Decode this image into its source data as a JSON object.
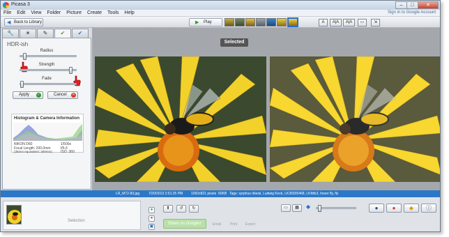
{
  "window": {
    "title": "Picasa 3",
    "buttons": {
      "minimize": "–",
      "maximize": "□",
      "close": "✕"
    }
  },
  "menu": {
    "items": [
      "File",
      "Edit",
      "View",
      "Folder",
      "Picture",
      "Create",
      "Tools",
      "Help"
    ],
    "sign_in": "Sign in to Google Account"
  },
  "toolbar": {
    "back_label": "Back to Library",
    "play_label": "Play",
    "text_buttons": [
      "A",
      "A|A",
      "A|A"
    ]
  },
  "edit_tabs": [
    "wrench-icon",
    "sun-icon",
    "brush-icon",
    "effects-icon",
    "effects2-icon"
  ],
  "effect_panel": {
    "title": "HDR-ish",
    "sliders": [
      {
        "label": "Radius",
        "value": 0.05
      },
      {
        "label": "Strength",
        "value": 0.95
      },
      {
        "label": "Fade",
        "value": 0.0
      }
    ],
    "apply_label": "Apply",
    "cancel_label": "Cancel"
  },
  "histogram": {
    "title": "Histogram & Camera Information",
    "camera_model": "NIKON D60",
    "focal_length": "Focal Length: 200.0mm",
    "equiv": "(35mm equivalent: 300mm)",
    "shutter": "1/500s",
    "aperture": "f/5.6",
    "iso": "ISO: 360"
  },
  "viewer": {
    "badge": "Selected"
  },
  "info_bar": {
    "filename": "LR_M72-83.jpg",
    "date": "7/20/2013 2:51:25 PM",
    "dimensions": "1092x821 pixels",
    "filesize": "60KB",
    "tags": "Tags: syrphus ribesii, Ludwig Keck, LK35935468, LKfdfx3, hover fly, fly"
  },
  "bottom": {
    "selection_label": "Selection",
    "share_label": "Share on Google+",
    "actions": [
      "Email",
      "Print",
      "Export"
    ]
  },
  "colors": {
    "accent": "#2b78c8",
    "window_bg": "#d9dde3",
    "viewer_bg": "#a4a8ad",
    "apply_green": "#2f9a2f",
    "cancel_red": "#d23a2a"
  }
}
